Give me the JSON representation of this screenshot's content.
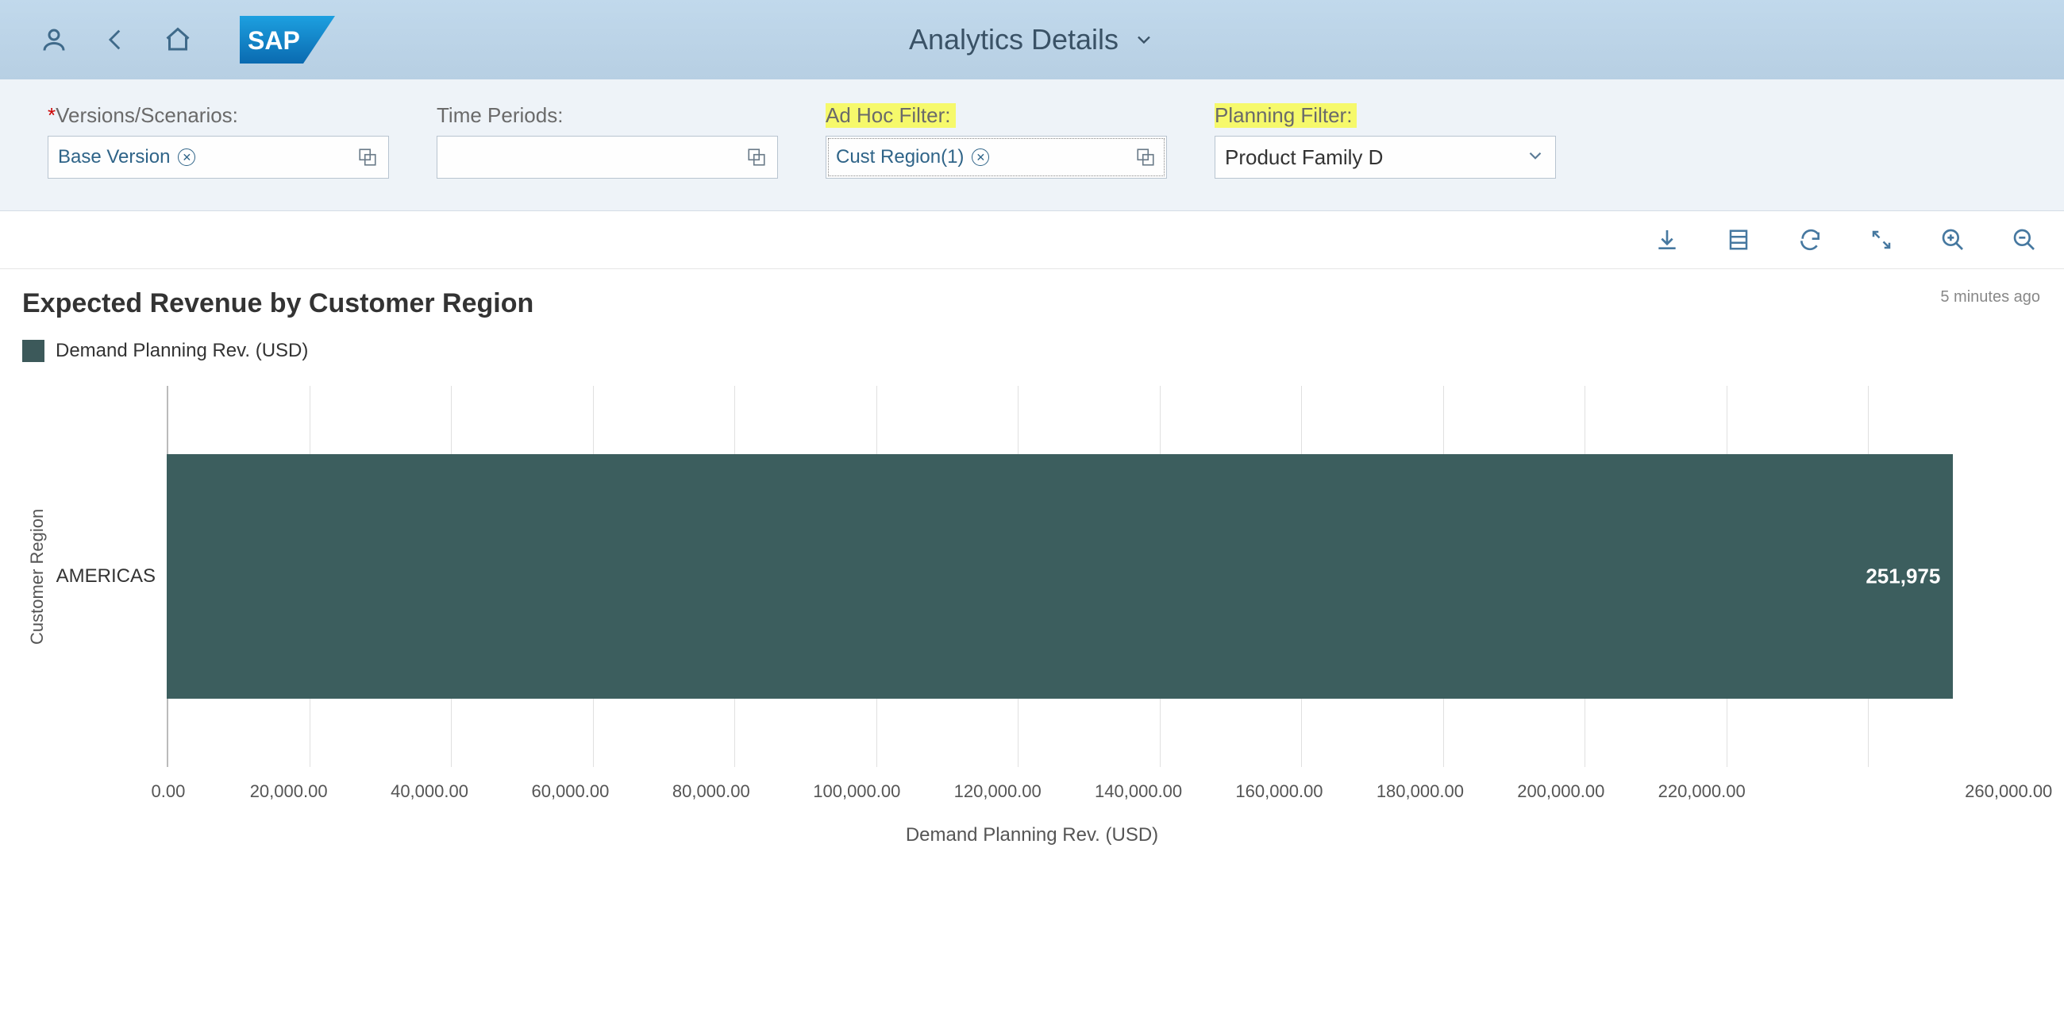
{
  "header": {
    "page_title": "Analytics Details",
    "logo_text": "SAP"
  },
  "filters": {
    "versions": {
      "label": "Versions/Scenarios:",
      "token": "Base Version"
    },
    "time_periods": {
      "label": "Time Periods:"
    },
    "adhoc": {
      "label": "Ad Hoc Filter:",
      "token": "Cust Region(1)"
    },
    "planning": {
      "label": "Planning Filter:",
      "value": "Product Family D"
    }
  },
  "toolbar": {},
  "chart_meta": {
    "title": "Expected Revenue by Customer Region",
    "legend": "Demand Planning Rev. (USD)",
    "timestamp": "5 minutes ago",
    "y_axis_title": "Customer Region",
    "x_axis_title": "Demand Planning Rev. (USD)"
  },
  "chart_data": {
    "type": "bar",
    "orientation": "horizontal",
    "categories": [
      "AMERICAS"
    ],
    "values": [
      251975
    ],
    "value_labels": [
      "251,975"
    ],
    "xlabel": "Demand Planning Rev. (USD)",
    "ylabel": "Customer Region",
    "xlim": [
      0,
      260000
    ],
    "xticks": [
      "0.00",
      "20,000.00",
      "40,000.00",
      "60,000.00",
      "80,000.00",
      "100,000.00",
      "120,000.00",
      "140,000.00",
      "160,000.00",
      "180,000.00",
      "200,000.00",
      "220,000.00",
      "260,000.00"
    ],
    "series": [
      {
        "name": "Demand Planning Rev. (USD)",
        "values": [
          251975
        ],
        "color": "#3c5e5e"
      }
    ]
  }
}
